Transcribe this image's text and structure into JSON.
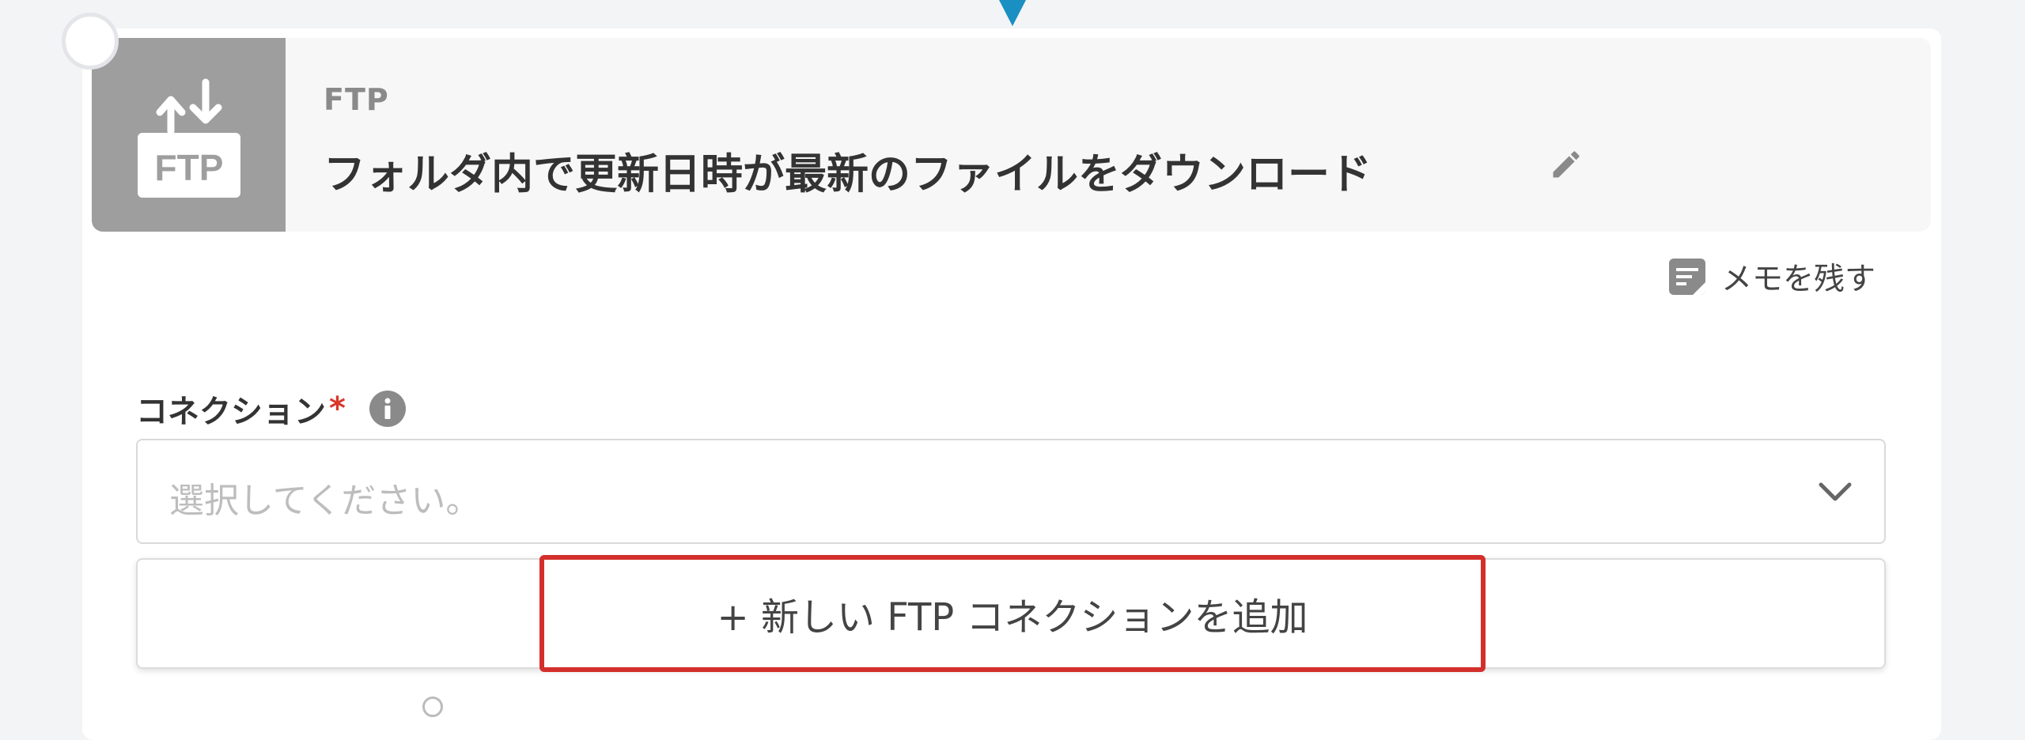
{
  "flow": {
    "connector_color": "#1a8fc2"
  },
  "step": {
    "app_name": "FTP",
    "icon_text": "FTP",
    "title": "フォルダ内で更新日時が最新のファイルをダウンロード",
    "icons": {
      "app": "ftp-upload-download-icon",
      "edit": "pencil-icon",
      "delete": "trash-icon"
    }
  },
  "memo": {
    "label": "メモを残す",
    "icon": "note-icon"
  },
  "connection": {
    "label": "コネクション",
    "required_mark": "*",
    "info_icon": "info-icon",
    "placeholder": "選択してください。",
    "dropdown_icon": "chevron-down-icon",
    "add_new_label": "+ 新しい FTP コネクションを追加",
    "highlight_color": "#d3302b"
  }
}
